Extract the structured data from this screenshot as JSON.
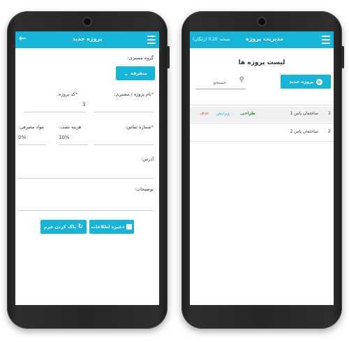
{
  "left": {
    "appbar_title": "پروژه جدید",
    "customer_group_label": "گروه مشتری:",
    "customer_group_select": "متفرقه",
    "project_name_label": "نام پروژه / مشتری:",
    "project_code_label": "کد پروژه:",
    "project_code_value": "3",
    "phone_label": "شماره تماس:",
    "install_cost_label": "هزینه نصب:",
    "install_cost_value": "10%",
    "consumables_label": "مواد مصرفی:",
    "consumables_value": "0%",
    "address_label": "آدرس:",
    "notes_label": "توضیحات:",
    "save_button": "ذخیره اطلاعات",
    "clear_button": "پاک کردن فرم"
  },
  "right": {
    "appbar_title": "مدیریت پروژه",
    "version_text": "نسخه: 0.20 (رایگان)",
    "page_title": "لیست پروژه ها",
    "new_project_button": "پروژه جدید",
    "search_placeholder": "جستجو",
    "rows": [
      {
        "num": "1",
        "name": "ساختمان پاس 1",
        "design": "طراحی",
        "edit": "ویرایش",
        "delete": "حذف"
      },
      {
        "num": "2",
        "name": "ساختمان پاس 2"
      }
    ]
  },
  "colors": {
    "accent": "#16b4d8",
    "design_green": "#2e9b2e",
    "delete_red": "#e53935"
  }
}
